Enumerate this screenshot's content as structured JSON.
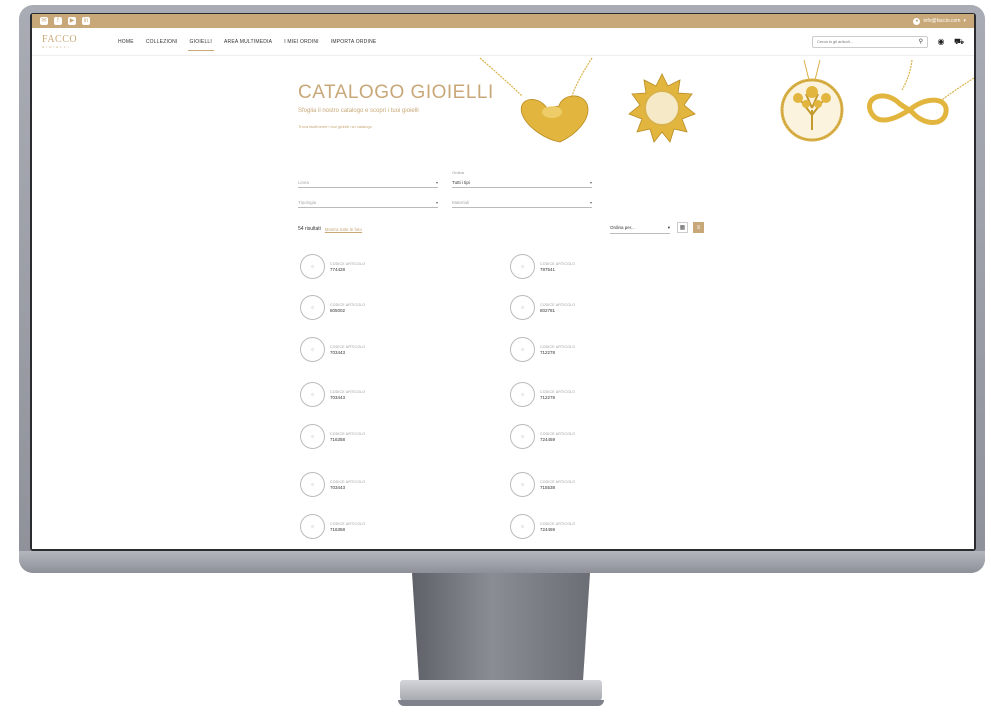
{
  "topbar": {
    "account_label": "info@faccio.com"
  },
  "nav": {
    "logo_main": "FACCO",
    "logo_sub": "GIOIELLI",
    "menu": [
      "HOME",
      "COLLEZIONI",
      "GIOIELLI",
      "AREA MULTIMEDIA",
      "I MIEI ORDINI",
      "IMPORTA ORDINE"
    ],
    "search_placeholder": "Cerca in gli articoli...",
    "search_icon": "magnifier-icon",
    "account_icon": "user-icon",
    "cart_icon": "cart-icon"
  },
  "hero": {
    "title": "CATALOGO GIOIELLI",
    "subtitle": "Sfoglia il nostro catalogo e scopri i tuoi gioielli",
    "note": "Trova facilmente i tuoi gioielli nel catalogo"
  },
  "filters": [
    {
      "label": "",
      "value": "Linea",
      "placeholder": true
    },
    {
      "label": "Ordina",
      "value": "Tutti i tipi",
      "placeholder": false
    },
    {
      "label": "",
      "value": "Tipologia",
      "placeholder": true
    },
    {
      "label": "",
      "value": "Materiali",
      "placeholder": true
    }
  ],
  "results": {
    "count": "54 risultati",
    "show_all": "Mostra tutte le foto",
    "sort_value": "Ordina per..."
  },
  "products": [
    {
      "label": "CODICE ARTICOLO",
      "code": "774428"
    },
    {
      "label": "CODICE ARTICOLO",
      "code": "787541"
    },
    {
      "label": "CODICE ARTICOLO",
      "code": "805002"
    },
    {
      "label": "CODICE ARTICOLO",
      "code": "802781"
    },
    {
      "label": "CODICE ARTICOLO",
      "code": "703443"
    },
    {
      "label": "CODICE ARTICOLO",
      "code": "712278"
    },
    {
      "label": "CODICE ARTICOLO",
      "code": "703443"
    },
    {
      "label": "CODICE ARTICOLO",
      "code": "712278"
    },
    {
      "label": "CODICE ARTICOLO",
      "code": "716358"
    },
    {
      "label": "CODICE ARTICOLO",
      "code": "724459"
    },
    {
      "label": "CODICE ARTICOLO",
      "code": "703443"
    },
    {
      "label": "CODICE ARTICOLO",
      "code": "715538"
    },
    {
      "label": "CODICE ARTICOLO",
      "code": "716358"
    },
    {
      "label": "CODICE ARTICOLO",
      "code": "724459"
    }
  ],
  "colors": {
    "accent": "#c8a878",
    "gold": "#e0b23c"
  }
}
